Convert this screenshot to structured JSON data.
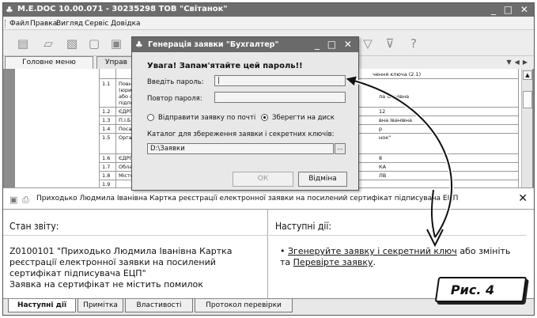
{
  "window": {
    "title": "M.E.DOC 10.00.071 - 30235298 ТОВ \"Світанок\"",
    "controls": "_ □ ✕"
  },
  "menu": [
    "Файл",
    "Правка",
    "Вигляд",
    "Сервіс",
    "Довідка"
  ],
  "tabs": {
    "main": "Головне меню",
    "second": "Управ"
  },
  "document": {
    "top_right": "чення ключа (2.1)",
    "rows": [
      {
        "num": "1.1",
        "label": "Повне і",
        "value": ""
      },
      {
        "num": "",
        "label": "(юриди",
        "value": ""
      },
      {
        "num": "",
        "label": "або фізи",
        "value": "ла Іванівна"
      },
      {
        "num": "",
        "label": "підписув",
        "value": ""
      },
      {
        "num": "1.2",
        "label": "ЄДРПО",
        "value": "12"
      },
      {
        "num": "1.3",
        "label": "П.І.Б.",
        "value": "вна Іванівна"
      },
      {
        "num": "1.4",
        "label": "Посада",
        "value": "р"
      },
      {
        "num": "1.5",
        "label": "Організ",
        "value": "нок\""
      },
      {
        "num": "1.6",
        "label": "ЄДРПО",
        "value": "8"
      },
      {
        "num": "1.7",
        "label": "Область",
        "value": "КА"
      },
      {
        "num": "1.8",
        "label": "Місто",
        "value": "ЛВ"
      },
      {
        "num": "1.9",
        "label": "",
        "value": ""
      }
    ]
  },
  "message_bar": {
    "text": "Приходько Людмила Іванівна Картка реєстрації електронної заявки на посилений сертифікат підписувача ЕЦП"
  },
  "panel_left": {
    "heading": "Стан звіту:",
    "report": "Z0100101 \"Приходько Людмила Іванівна Картка реєстрації електронної заявки на посилений сертифікат підписувача ЕЦП\"",
    "status": "Заявка на сертифікат не містить помилок"
  },
  "panel_right": {
    "heading": "Наступні дії:",
    "bullet": "•",
    "link1": "Згенеруйте заявку і секретний ключ",
    "middle": "або змініть та",
    "link2": "Перевірте заявку",
    "end": "."
  },
  "bottom_tabs": [
    "Наступні дії",
    "Примітка",
    "Властивості",
    "Протокол перевірки"
  ],
  "dialog": {
    "title": "Генерація заявки \"Бухгалтер\"",
    "warning": "Увага! Запам'ятайте цей пароль!!",
    "password_label": "Введіть пароль:",
    "password_value": "|",
    "repeat_label": "Повтор пароля:",
    "repeat_value": "",
    "radio_mail": "Відправити заявку по почті",
    "radio_disk": "Зберегти на диск",
    "catalog_label": "Каталог для збереження заявки і секретних ключів:",
    "catalog_value": "D:\\Заявки",
    "browse": "...",
    "ok": "ОК",
    "cancel": "Відміна"
  },
  "callout": "Рис. 4"
}
